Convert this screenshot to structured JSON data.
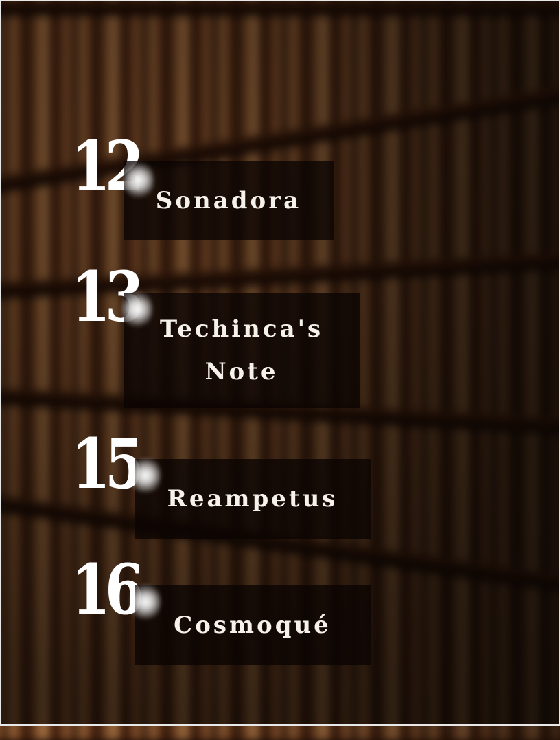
{
  "entries": [
    {
      "number": "12",
      "title": "Sonadora"
    },
    {
      "number": "13",
      "title_line1": "Techinca's",
      "title_line2": "Note"
    },
    {
      "number": "15",
      "title": "Reampetus"
    },
    {
      "number": "16",
      "title": "Cosmoqué"
    }
  ]
}
